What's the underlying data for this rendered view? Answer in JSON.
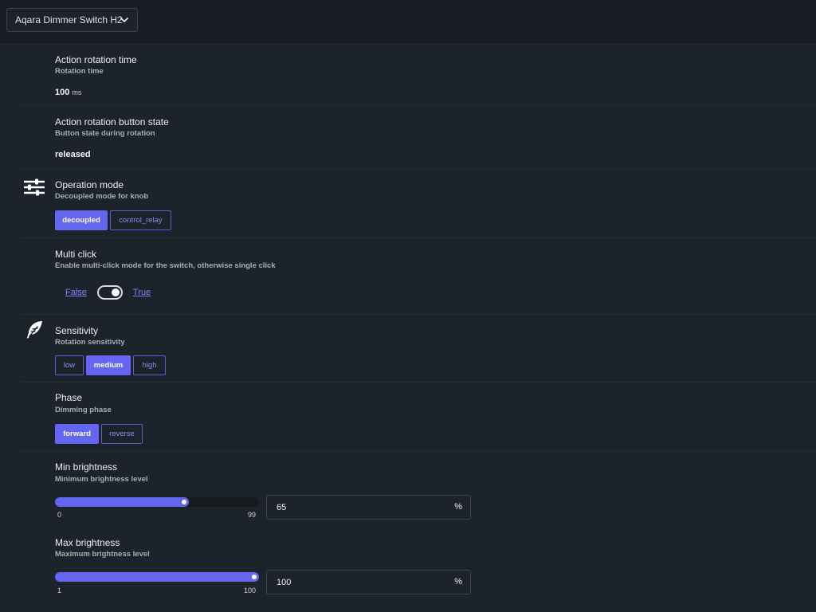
{
  "header": {
    "device_label": "Aqara Dimmer Switch H2"
  },
  "settings": {
    "rotation_time": {
      "title": "Action rotation time",
      "description": "Rotation time",
      "value": "100",
      "unit": "ms"
    },
    "rotation_button_state": {
      "title": "Action rotation button state",
      "description": "Button state during rotation",
      "value": "released"
    },
    "operation_mode": {
      "icon": "sliders-icon",
      "title": "Operation mode",
      "description": "Decoupled mode for knob",
      "options": [
        "decoupled",
        "control_relay"
      ],
      "selected": "decoupled"
    },
    "multi_click": {
      "title": "Multi click",
      "description": "Enable multi-click mode for the switch, otherwise single click",
      "false_label": "False",
      "true_label": "True",
      "value": true
    },
    "sensitivity": {
      "icon": "feather-icon",
      "title": "Sensitivity",
      "description": "Rotation sensitivity",
      "options": [
        "low",
        "medium",
        "high"
      ],
      "selected": "medium"
    },
    "phase": {
      "title": "Phase",
      "description": "Dimming phase",
      "options": [
        "forward",
        "reverse"
      ],
      "selected": "forward"
    },
    "min_brightness": {
      "title": "Min brightness",
      "description": "Minimum brightness level",
      "min": "0",
      "max": "99",
      "value": "65",
      "unit": "%"
    },
    "max_brightness": {
      "title": "Max brightness",
      "description": "Maximum brightness level",
      "min": "1",
      "max": "100",
      "value": "100",
      "unit": "%"
    }
  },
  "colors": {
    "accent": "#6466f1",
    "background": "#1d232a",
    "topbar": "#191e24"
  }
}
